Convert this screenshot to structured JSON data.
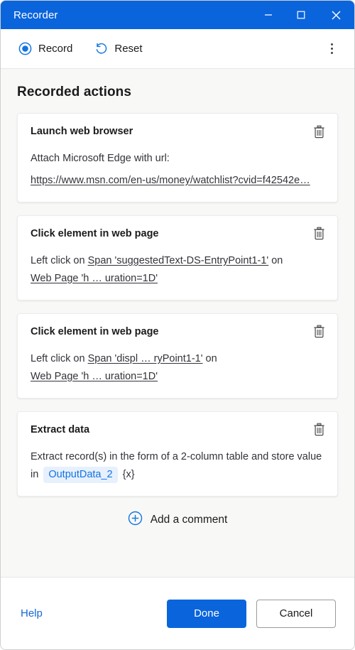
{
  "window": {
    "title": "Recorder",
    "accent_color": "#0a64dc",
    "controls": {
      "minimize": "minimize-icon",
      "maximize": "maximize-icon",
      "close": "close-icon"
    }
  },
  "toolbar": {
    "record_label": "Record",
    "record_icon": "record-circle-icon",
    "reset_label": "Reset",
    "reset_icon": "undo-arrow-icon",
    "more_icon": "more-vertical-icon"
  },
  "main": {
    "section_title": "Recorded actions",
    "actions": [
      {
        "title": "Launch web browser",
        "delete_icon": "trash-icon",
        "body_prefix": "Attach Microsoft Edge with url:",
        "url": "https://www.msn.com/en-us/money/watchlist?cvid=f42542e…"
      },
      {
        "title": "Click element in web page",
        "delete_icon": "trash-icon",
        "line1_prefix": "Left click on",
        "line1_target": "Span 'suggestedText-DS-EntryPoint1-1'",
        "line1_suffix": "on",
        "line2_target": "Web Page 'h … uration=1D'"
      },
      {
        "title": "Click element in web page",
        "delete_icon": "trash-icon",
        "line1_prefix": "Left click on",
        "line1_target": "Span 'displ … ryPoint1-1'",
        "line1_suffix": "on",
        "line2_target": "Web Page 'h … uration=1D'"
      },
      {
        "title": "Extract data",
        "delete_icon": "trash-icon",
        "body_prefix": "Extract record(s) in the form of a 2-column table and store value in",
        "variable": "OutputData_2",
        "variable_suffix": "{x}"
      }
    ],
    "add_comment_label": "Add a comment",
    "add_comment_icon": "plus-circle-icon"
  },
  "footer": {
    "help_label": "Help",
    "done_label": "Done",
    "cancel_label": "Cancel"
  }
}
